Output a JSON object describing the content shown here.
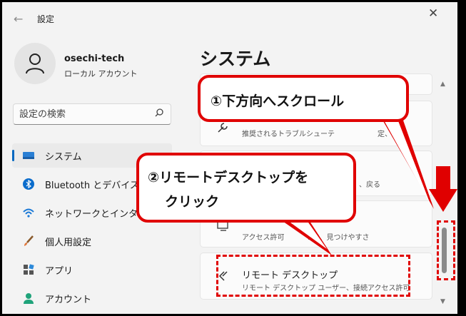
{
  "window": {
    "title": "設定",
    "back_icon": "back-arrow-icon",
    "close_icon": "close-icon"
  },
  "user": {
    "name": "osechi-tech",
    "account_type": "ローカル アカウント"
  },
  "search": {
    "placeholder": "設定の検索"
  },
  "sidebar": {
    "items": [
      {
        "label": "システム",
        "icon": "system-display-icon",
        "active": true
      },
      {
        "label": "Bluetooth とデバイス",
        "icon": "bluetooth-icon"
      },
      {
        "label": "ネットワークとインターネット",
        "icon": "wifi-icon"
      },
      {
        "label": "個人用設定",
        "icon": "brush-icon"
      },
      {
        "label": "アプリ",
        "icon": "apps-icon"
      },
      {
        "label": "アカウント",
        "icon": "account-icon"
      }
    ]
  },
  "main": {
    "heading": "システム",
    "cards": [
      {
        "title": "",
        "subtitle": "推奨されるトラブルシューテ",
        "right": "定、履歴",
        "icon": "wrench-icon"
      },
      {
        "title": "",
        "subtitle": "",
        "right": "、戻る",
        "icon": "recovery-icon"
      },
      {
        "title": "",
        "subtitle": "アクセス許可",
        "right": "PIN、見つけやすさ",
        "icon": "projection-icon"
      },
      {
        "title": "リモート デスクトップ",
        "subtitle": "リモート デスクトップ ユーザー、接続アクセス許可",
        "icon": "remote-desktop-icon"
      }
    ]
  },
  "annotations": {
    "callout1": "①下方向へスクロール",
    "callout2_line1": "②リモートデスクトップを",
    "callout2_line2": "クリック",
    "color": "#e00000"
  },
  "colors": {
    "accent": "#0067c0",
    "annotation_red": "#e00000",
    "background": "#f3f3f3"
  }
}
